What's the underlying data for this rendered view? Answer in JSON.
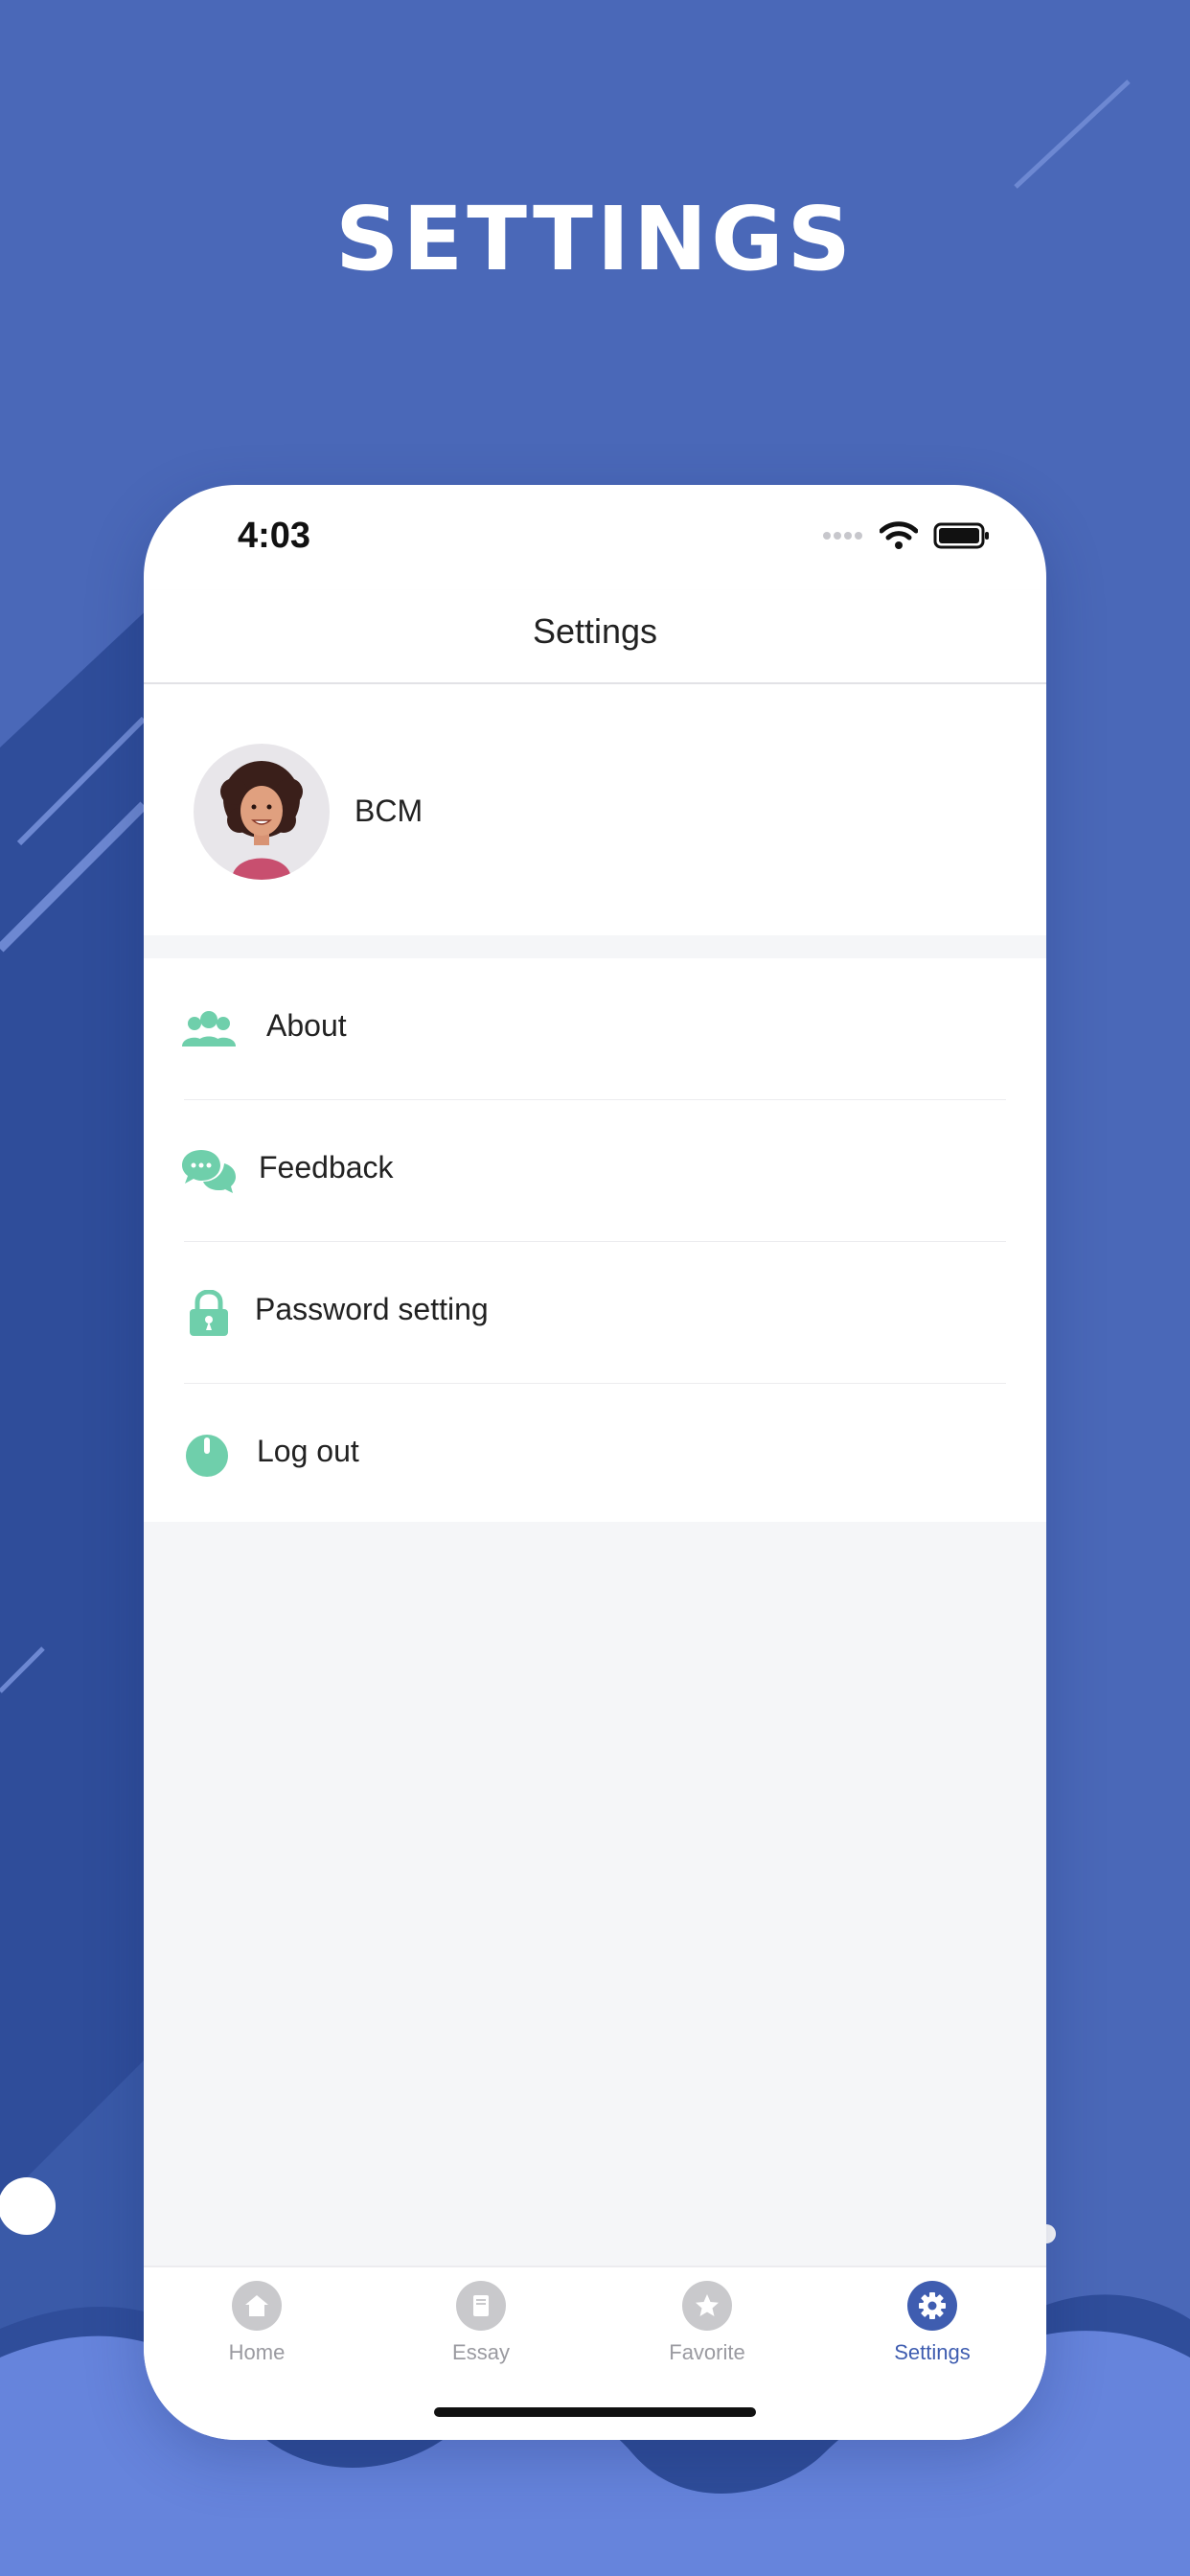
{
  "headline": "SETTINGS",
  "colors": {
    "background": "#4a68b8",
    "accent": "#3f5db0",
    "icon_green": "#6fcfab",
    "inactive": "#c9c9cc"
  },
  "status_bar": {
    "time": "4:03",
    "icons": [
      "signal-dots-icon",
      "wifi-icon",
      "battery-icon"
    ]
  },
  "nav": {
    "title": "Settings"
  },
  "profile": {
    "name": "BCM",
    "avatar_icon": "avatar-woman-icon"
  },
  "menu": {
    "items": [
      {
        "label": "About",
        "icon": "people-icon"
      },
      {
        "label": "Feedback",
        "icon": "chat-bubbles-icon"
      },
      {
        "label": "Password setting",
        "icon": "lock-icon"
      },
      {
        "label": "Log out",
        "icon": "power-icon"
      }
    ]
  },
  "tabs": [
    {
      "label": "Home",
      "icon": "home-icon",
      "active": false
    },
    {
      "label": "Essay",
      "icon": "book-icon",
      "active": false
    },
    {
      "label": "Favorite",
      "icon": "star-icon",
      "active": false
    },
    {
      "label": "Settings",
      "icon": "gear-icon",
      "active": true
    }
  ]
}
